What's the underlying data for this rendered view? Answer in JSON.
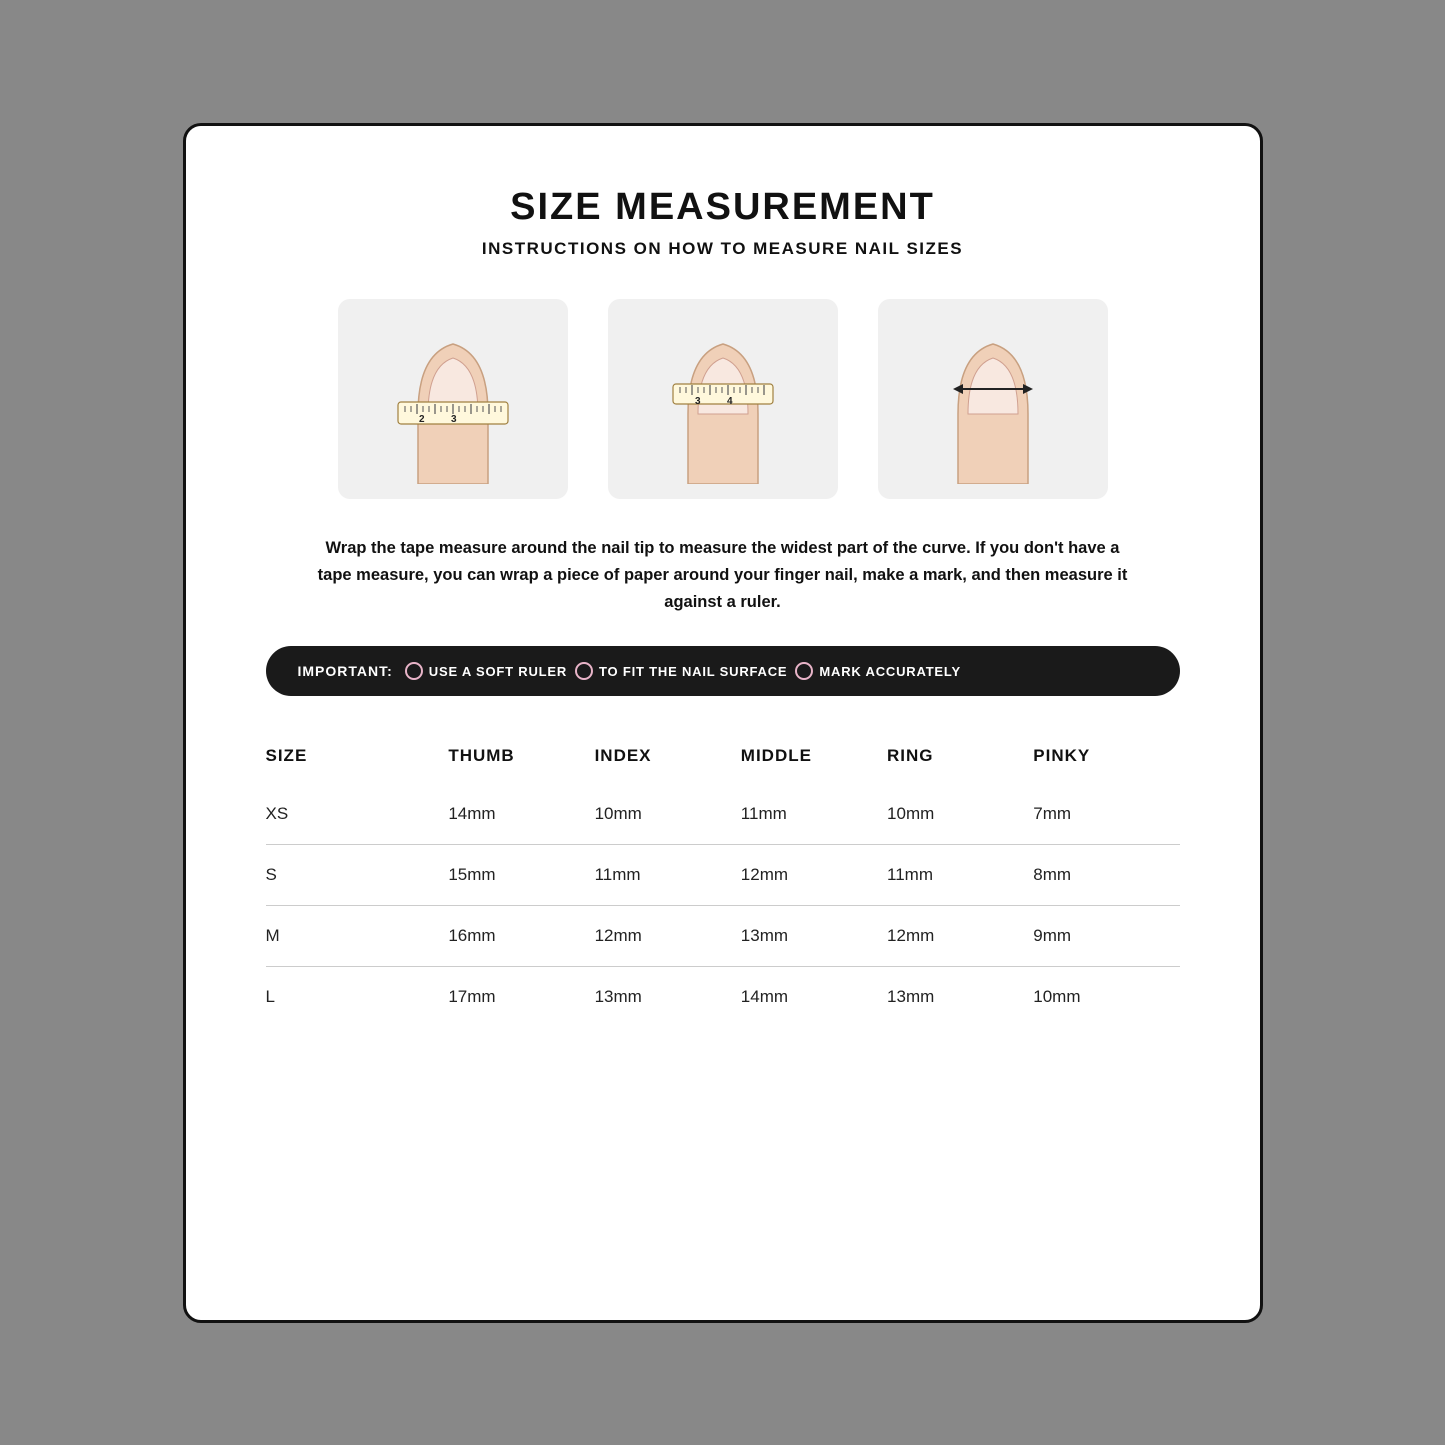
{
  "page": {
    "title": "SIZE MEASUREMENT",
    "subtitle": "INSTRUCTIONS ON HOW TO MEASURE NAIL SIZES",
    "description": "Wrap the tape measure around the nail tip to measure the widest part of the curve. If you don't have a tape measure, you can wrap a piece of paper around your finger nail, make a mark, and then measure it against a ruler.",
    "important_label": "IMPORTANT:",
    "important_items": [
      "USE A SOFT RULER",
      "TO FIT THE NAIL SURFACE",
      "MARK ACCURATELY"
    ],
    "table": {
      "headers": [
        "SIZE",
        "THUMB",
        "INDEX",
        "MIDDLE",
        "RING",
        "PINKY"
      ],
      "rows": [
        [
          "XS",
          "14mm",
          "10mm",
          "11mm",
          "10mm",
          "7mm"
        ],
        [
          "S",
          "15mm",
          "11mm",
          "12mm",
          "11mm",
          "8mm"
        ],
        [
          "M",
          "16mm",
          "12mm",
          "13mm",
          "12mm",
          "9mm"
        ],
        [
          "L",
          "17mm",
          "13mm",
          "14mm",
          "13mm",
          "10mm"
        ]
      ]
    }
  }
}
